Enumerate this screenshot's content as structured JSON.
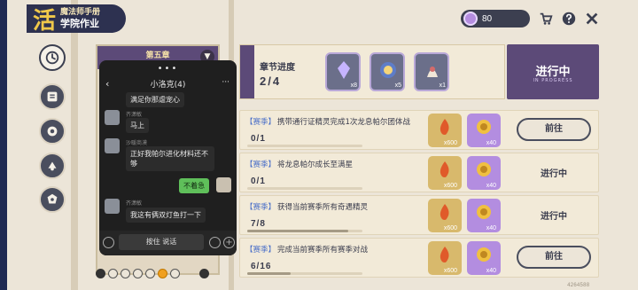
{
  "header": {
    "subtitle": "魔法师手册",
    "title": "学院作业",
    "logo_glyph": "活"
  },
  "currency": {
    "amount": "80",
    "icon": "gem-icon"
  },
  "top_icons": [
    "shop-icon",
    "help-icon",
    "close-icon"
  ],
  "left_nav": [
    "clock-icon",
    "book-icon",
    "puzzle-icon",
    "notes-icon",
    "badge-icon"
  ],
  "chapter_card": {
    "banner": "第五章",
    "icon": "▼"
  },
  "chat": {
    "dots": "•••",
    "back": "‹",
    "title": "小洛克(4)",
    "more": "···",
    "messages": [
      {
        "sender": "",
        "text": "满足你那虐宠心",
        "mine": false
      },
      {
        "sender": "齐潇敏",
        "text": "马上",
        "mine": false
      },
      {
        "sender": "沙暖商漠",
        "text": "正好我帕尔进化材料还不够",
        "mine": false
      },
      {
        "sender": "",
        "text": "不着急",
        "mine": true
      },
      {
        "sender": "齐潇敏",
        "text": "我这有俩双灯鱼打一下",
        "mine": false
      }
    ],
    "hold_to_talk": "按住 说话",
    "plus": "+"
  },
  "progress": {
    "label": "章节进度",
    "value": "2/4",
    "status": "进行中",
    "status_sub": "IN PROGRESS",
    "rewards": [
      {
        "qty": "x8",
        "icon": "crystal-icon"
      },
      {
        "qty": "x5",
        "icon": "orb-icon"
      },
      {
        "qty": "x1",
        "icon": "spirit-icon"
      }
    ]
  },
  "tasks": [
    {
      "season": "【赛季】",
      "desc": "携带通行证精灵完成1次龙息帕尔团体战",
      "progress": "0/1",
      "fill": 0,
      "action": "前往",
      "action_type": "button",
      "rewards": [
        {
          "qty": "x600",
          "tone": "gold"
        },
        {
          "qty": "x40",
          "tone": "purple"
        }
      ]
    },
    {
      "season": "【赛季】",
      "desc": "将龙息帕尔成长至满星",
      "progress": "0/1",
      "fill": 0,
      "action": "进行中",
      "action_type": "state",
      "rewards": [
        {
          "qty": "x600",
          "tone": "gold"
        },
        {
          "qty": "x40",
          "tone": "purple"
        }
      ]
    },
    {
      "season": "【赛季】",
      "desc": "获得当前赛季所有奇遇精灵",
      "progress": "7/8",
      "fill": 0.875,
      "action": "进行中",
      "action_type": "state",
      "rewards": [
        {
          "qty": "x600",
          "tone": "gold"
        },
        {
          "qty": "x40",
          "tone": "purple"
        }
      ]
    },
    {
      "season": "【赛季】",
      "desc": "完成当前赛季所有赛季对战",
      "progress": "6/16",
      "fill": 0.375,
      "action": "前往",
      "action_type": "button",
      "rewards": [
        {
          "qty": "x600",
          "tone": "gold"
        },
        {
          "qty": "x40",
          "tone": "purple"
        }
      ]
    }
  ],
  "uid": "4264588"
}
